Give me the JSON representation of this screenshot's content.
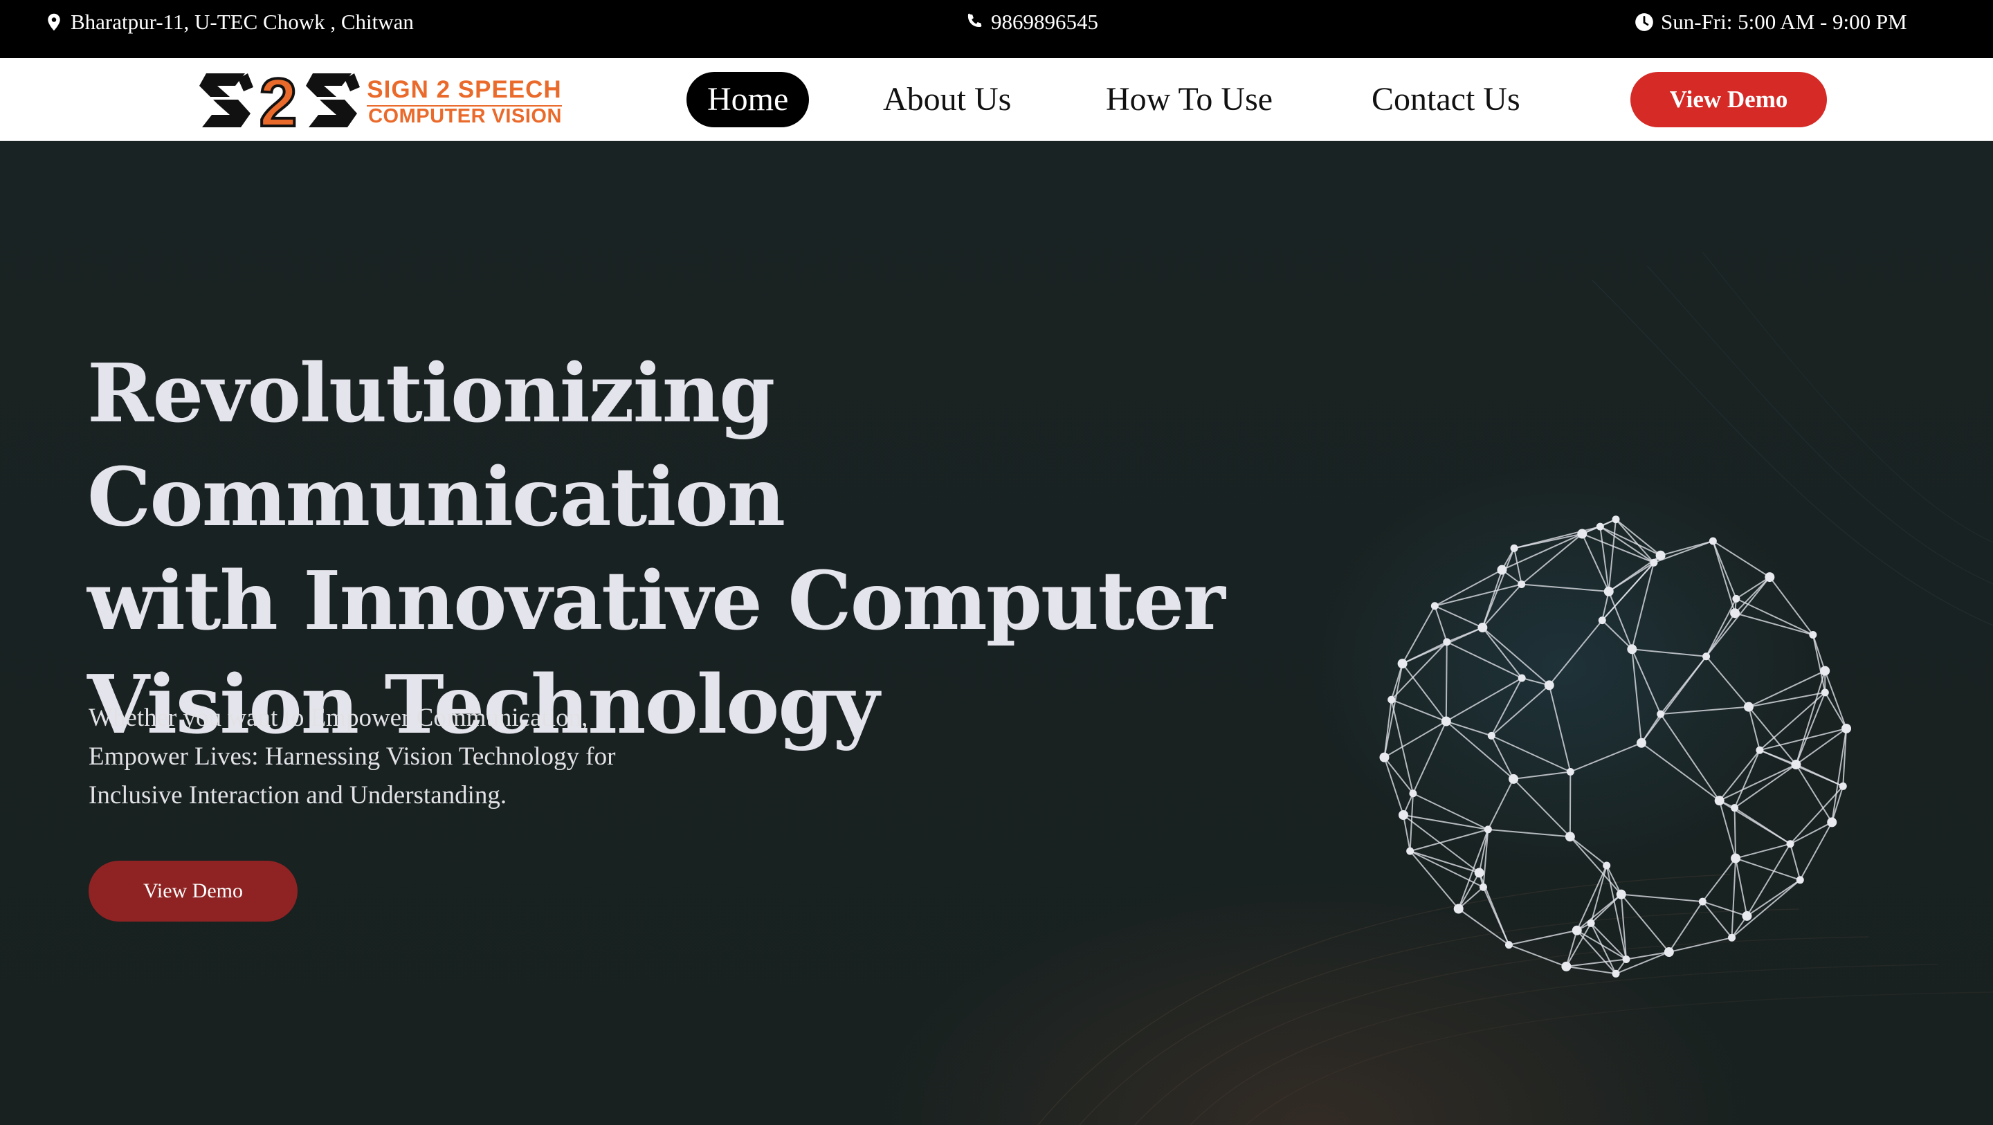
{
  "topbar": {
    "address": "Bharatpur-11, U-TEC Chowk , Chitwan",
    "phone": "9869896545",
    "hours": "Sun-Fri: 5:00 AM - 9:00 PM",
    "icons": [
      "map-pin-icon",
      "phone-icon",
      "clock-icon"
    ]
  },
  "logo": {
    "mark_text": "S2S",
    "brand_line1": "SIGN 2 SPEECH",
    "brand_line2": "COMPUTER VISION",
    "colors": {
      "accent": "#ea6a2b",
      "dark": "#111111"
    }
  },
  "nav": {
    "items": [
      {
        "label": "Home",
        "active": true
      },
      {
        "label": "About Us",
        "active": false
      },
      {
        "label": "How To Use",
        "active": false
      },
      {
        "label": "Contact Us",
        "active": false
      }
    ],
    "cta_label": "View Demo",
    "colors": {
      "active_bg": "#000000",
      "cta_bg": "#d52a26"
    }
  },
  "hero": {
    "title_line1": "Revolutionizing Communication",
    "title_line2": "with Innovative Computer",
    "title_line3": "Vision Technology",
    "sub_line1": "Whether you want to Empower Communication,",
    "sub_line2": "Empower Lives: Harnessing Vision Technology for",
    "sub_line3": "Inclusive Interaction and Understanding.",
    "cta_label": "View Demo",
    "colors": {
      "background": "#1a2222",
      "cta_bg": "#8f2323",
      "text": "#e4e4ec"
    }
  }
}
